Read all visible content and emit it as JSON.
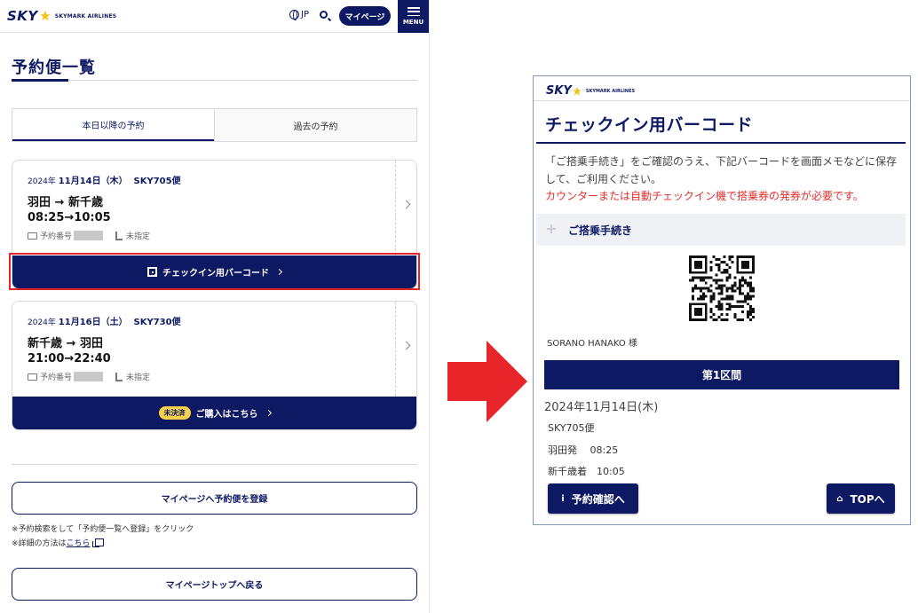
{
  "left": {
    "logo": {
      "sky": "SKY",
      "brand": "SKYMARK AIRLINES"
    },
    "header": {
      "lang": "JP",
      "mypage_label": "マイページ",
      "menu_label": "MENU"
    },
    "page_title": "予約便一覧",
    "tabs": [
      {
        "label": "本日以降の予約"
      },
      {
        "label": "過去の予約"
      }
    ],
    "cards": [
      {
        "year": "2024年",
        "date": "11月14日（木）",
        "flight": "SKY705便",
        "route_from": "羽田",
        "route_to": "新千歳",
        "time_dep": "08:25",
        "time_arr": "10:05",
        "booking_label": "予約番号",
        "seat_label": "未指定",
        "action_label": "チェックイン用バーコード"
      },
      {
        "year": "2024年",
        "date": "11月16日（土）",
        "flight": "SKY730便",
        "route_from": "新千歳",
        "route_to": "羽田",
        "time_dep": "21:00",
        "time_arr": "22:40",
        "booking_label": "予約番号",
        "seat_label": "未指定",
        "unpaid_badge": "未決済",
        "action_label": "ご購入はこちら"
      }
    ],
    "register_button": "マイページへ予約便を登録",
    "note1": "※予約検索をして「予約便一覧へ登録」をクリック",
    "note2_prefix": "※詳細の方法は",
    "note2_link": "こちら",
    "back_button": "マイページトップへ戻る"
  },
  "right": {
    "logo": {
      "sky": "SKY",
      "brand": "SKYMARK AIRLINES"
    },
    "title": "チェックイン用バーコード",
    "desc": "「ご搭乗手続き」をご確認のうえ、下記バーコードを画面メモなどに保存して、ご利用ください。",
    "warning": "カウンターまたは自動チェックイン機で搭乗券の発券が必要です。",
    "section_header": "ご搭乗手続き",
    "passenger": "SORANO HANAKO 様",
    "segment_label": "第1区間",
    "date": "2024年11月14日(木)",
    "flight": "SKY705便",
    "dep_line": "羽田発　 08:25",
    "arr_line": "新千歳着　10:05",
    "confirm_button": "予約確認へ",
    "top_button": "TOPへ"
  },
  "colors": {
    "brand_navy": "#0d1a63",
    "highlight_red": "#e5252c",
    "arrow_red": "#e8262a",
    "unpaid_yellow": "#f5d04c",
    "warning_red": "#e62d2d"
  }
}
